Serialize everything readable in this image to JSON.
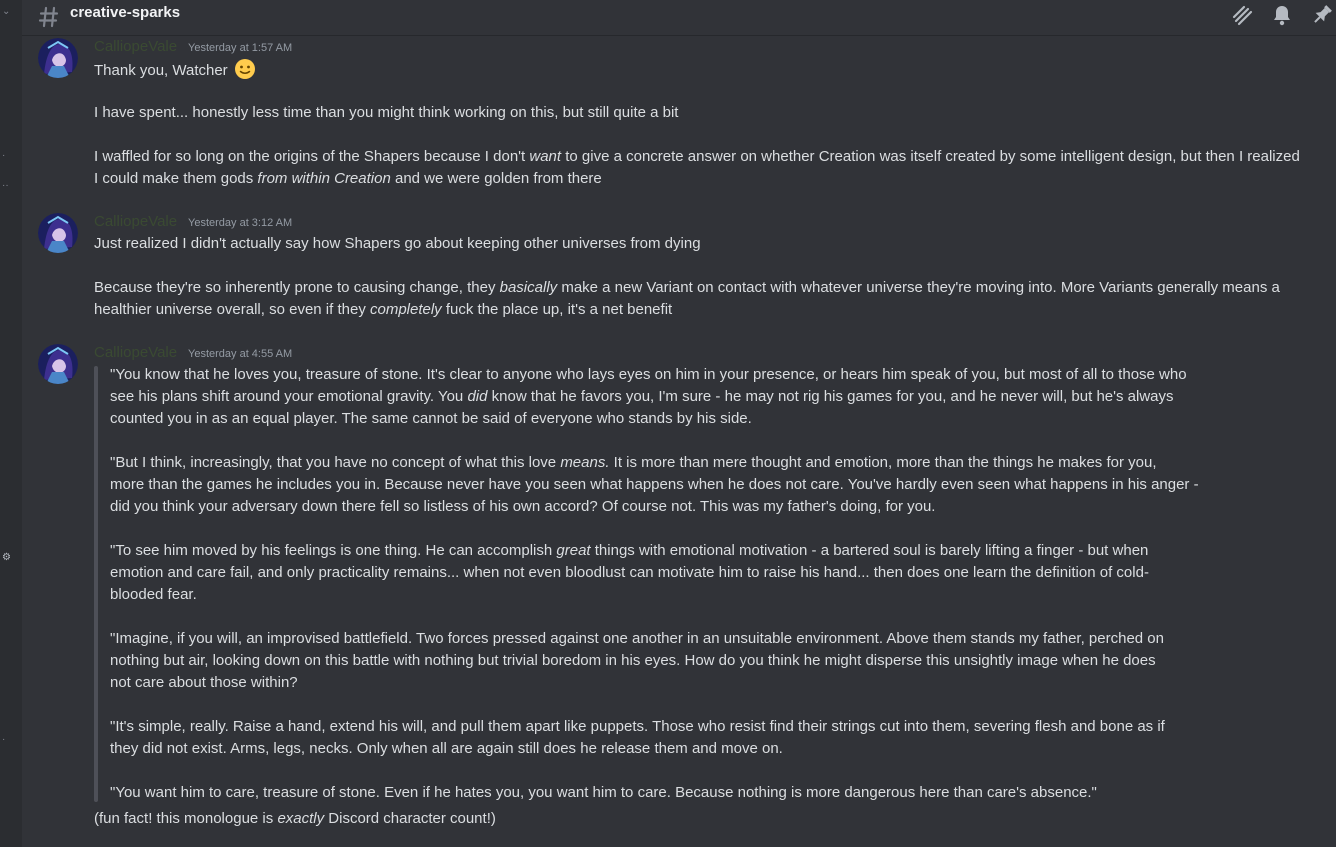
{
  "channel": {
    "name": "creative-sparks"
  },
  "header_icons": [
    "threads-icon",
    "bell-icon",
    "pin-icon"
  ],
  "colors": {
    "background": "#313338",
    "author": "#3a4a32",
    "text": "#dbdee1",
    "quote_bar": "#4e5058"
  },
  "messages": [
    {
      "author": "CalliopeVale",
      "timestamp": "Yesterday at 1:57 AM",
      "lines": [
        {
          "parts": [
            {
              "t": "Thank you, Watcher "
            }
          ],
          "emoji": "slightly-smiling-face-icon"
        },
        {
          "parts": [
            {
              "t": "I have spent... honestly less time than you might think working on this, but still quite a bit"
            }
          ]
        },
        {
          "parts": [
            {
              "t": "I waffled for so long on the origins of the Shapers because I don't "
            },
            {
              "t": "want",
              "i": true
            },
            {
              "t": " to give a concrete answer on whether Creation was itself created by some intelligent design, but then I realized"
            }
          ]
        },
        {
          "parts": [
            {
              "t": "I could make them gods "
            },
            {
              "t": "from within Creation",
              "i": true
            },
            {
              "t": " and we were golden from there"
            }
          ]
        }
      ]
    },
    {
      "author": "CalliopeVale",
      "timestamp": "Yesterday at 3:12 AM",
      "lines": [
        {
          "parts": [
            {
              "t": "Just realized I didn't actually say how Shapers go about keeping other universes from dying"
            }
          ]
        },
        {
          "parts": [
            {
              "t": "Because they're so inherently prone to causing change, they "
            },
            {
              "t": "basically",
              "i": true
            },
            {
              "t": " make a new Variant on contact with whatever universe they're moving into. More Variants generally means a"
            }
          ]
        },
        {
          "parts": [
            {
              "t": "healthier universe overall, so even if they "
            },
            {
              "t": "completely",
              "i": true
            },
            {
              "t": " fuck the place up, it's a net benefit"
            }
          ]
        }
      ]
    },
    {
      "author": "CalliopeVale",
      "timestamp": "Yesterday at 4:55 AM",
      "quote_lines": [
        {
          "parts": [
            {
              "t": "\"You know that he loves you, treasure of stone. It's clear to anyone who lays eyes on him in your presence, or hears him speak of you, but most of all to those who"
            }
          ]
        },
        {
          "parts": [
            {
              "t": "see his plans shift around your emotional gravity. You "
            },
            {
              "t": "did",
              "i": true
            },
            {
              "t": " know that he favors you, I'm sure - he may not rig his games for you, and he never will, but he's always"
            }
          ]
        },
        {
          "parts": [
            {
              "t": "counted you in as an equal player. The same cannot be said of everyone who stands by his side."
            }
          ]
        },
        {
          "parts": [
            {
              "t": "\"But I think, increasingly, that you have no concept of what this love "
            },
            {
              "t": "means.",
              "i": true
            },
            {
              "t": " It is more than mere thought and emotion, more than the things he makes for you,"
            }
          ]
        },
        {
          "parts": [
            {
              "t": "more than the games he includes you in. Because never have you seen what happens when he does not care. You've hardly even seen what happens in his anger -"
            }
          ]
        },
        {
          "parts": [
            {
              "t": "did you think your adversary down there fell so listless of his own accord? Of course not. This was my father's doing, for you."
            }
          ]
        },
        {
          "parts": [
            {
              "t": "\"To see him moved by his feelings is one thing. He can accomplish "
            },
            {
              "t": "great",
              "i": true
            },
            {
              "t": " things with emotional motivation - a bartered soul is barely lifting a finger - but when"
            }
          ]
        },
        {
          "parts": [
            {
              "t": "emotion and care fail, and only practicality remains... when not even bloodlust can motivate him to raise his hand... then does one learn the definition of cold-"
            }
          ]
        },
        {
          "parts": [
            {
              "t": "blooded fear."
            }
          ]
        },
        {
          "parts": [
            {
              "t": "\"Imagine, if you will, an improvised battlefield. Two forces pressed against one another in an unsuitable environment. Above them stands my father, perched on"
            }
          ]
        },
        {
          "parts": [
            {
              "t": "nothing but air, looking down on this battle with nothing but trivial boredom in his eyes. How do you think he might disperse this unsightly image when he does"
            }
          ]
        },
        {
          "parts": [
            {
              "t": "not care about those within?"
            }
          ]
        },
        {
          "parts": [
            {
              "t": "\"It's simple, really. Raise a hand, extend his will, and pull them apart like puppets. Those who resist find their strings cut into them, severing flesh and bone as if"
            }
          ]
        },
        {
          "parts": [
            {
              "t": "they did not exist. Arms, legs, necks. Only when all are again still does he release them and move on."
            }
          ]
        },
        {
          "parts": [
            {
              "t": "\"You want him to care, treasure of stone. Even if he hates you, you want him to care. Because nothing is more dangerous here than care's absence.\""
            }
          ]
        }
      ],
      "after_lines": [
        {
          "parts": [
            {
              "t": "(fun fact! this monologue is "
            },
            {
              "t": "exactly",
              "i": true
            },
            {
              "t": " Discord character count!)"
            }
          ]
        }
      ]
    }
  ]
}
